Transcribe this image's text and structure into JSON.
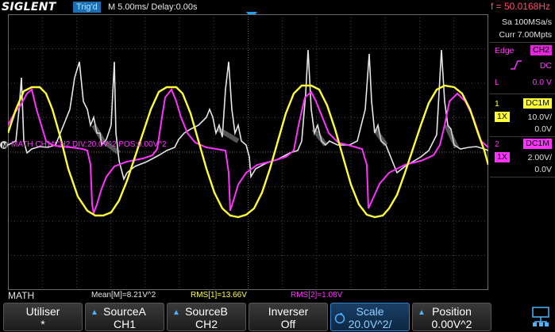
{
  "header": {
    "brand": "SIGLENT",
    "trigger_status": "Trig'd",
    "timebase": "M 5.00ms/ Delay:0.00s",
    "frequency": "f = 50.0168Hz"
  },
  "acquisition": {
    "sample_rate": "Sa 100MSa/s",
    "memory_depth": "Curr 7.00Mpts"
  },
  "trigger": {
    "type_label": "Edge",
    "source": "CH2",
    "coupling": "DC",
    "level_label": "L",
    "level": "0.0 V"
  },
  "channel1": {
    "number": "1",
    "coupling": "DC1M",
    "probe": "1X",
    "scale": "10.0V/",
    "offset": "0.0V"
  },
  "channel2": {
    "number": "2",
    "coupling": "DC1M",
    "probe": "1X",
    "scale": "2.00V/",
    "offset": "0.0V"
  },
  "math": {
    "overlay_label": "MATH  CH1*CH2  DIV:20.0V^2  POS:0.00V^2",
    "status_label": "MATH",
    "mean": "Mean[M]=8.21V^2",
    "rms1": "RMS[1]=13.66V",
    "rms2": "RMS[2]=1.08V"
  },
  "softkeys": [
    {
      "l1": "Utiliser",
      "l2": "*",
      "arrow": false
    },
    {
      "l1": "SourceA",
      "l2": "CH1",
      "arrow": true
    },
    {
      "l1": "SourceB",
      "l2": "CH2",
      "arrow": true
    },
    {
      "l1": "Inverser",
      "l2": "Off",
      "arrow": false
    },
    {
      "l1": "Scale",
      "l2": "20.0V^2/",
      "arrow": false,
      "active": true
    },
    {
      "l1": "Position",
      "l2": "0.00V^2",
      "arrow": true
    }
  ],
  "colors": {
    "ch1": "#ffff33",
    "ch2": "#ff33ff",
    "math": "#e6e6e6",
    "grid": "#5a5a5a",
    "trigger_arrow": "#1ea0ff"
  }
}
